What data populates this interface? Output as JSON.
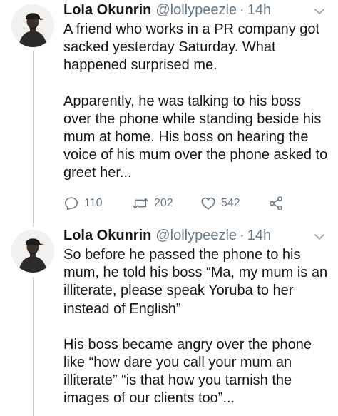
{
  "tweets": [
    {
      "author": {
        "display_name": "Lola Okunrin",
        "handle": "@lollypeezle",
        "separator": "·",
        "time": "14h"
      },
      "paragraphs": [
        "A friend who works in a PR company got sacked yesterday Saturday. What happened surprised me.",
        "Apparently, he was talking to his boss over the phone while standing beside his mum at home. His boss on hearing the voice of his mum over the phone asked to greet her..."
      ],
      "actions": {
        "reply_icon": "reply-icon",
        "reply_count": "110",
        "retweet_icon": "retweet-icon",
        "retweet_count": "202",
        "like_icon": "heart-icon",
        "like_count": "542",
        "share_icon": "share-icon"
      }
    },
    {
      "author": {
        "display_name": "Lola Okunrin",
        "handle": "@lollypeezle",
        "separator": "·",
        "time": "14h"
      },
      "paragraphs": [
        "So before he passed the phone to his mum, he told his boss “Ma, my mum is an illiterate, please speak Yoruba to her instead of English”",
        "His boss became angry over the phone like “how dare you call your mum an illiterate” “is that how you tarnish the images of our clients too”..."
      ]
    }
  ],
  "colors": {
    "text": "#14171a",
    "secondary": "#657786",
    "thread_line": "#c4cfd6"
  }
}
